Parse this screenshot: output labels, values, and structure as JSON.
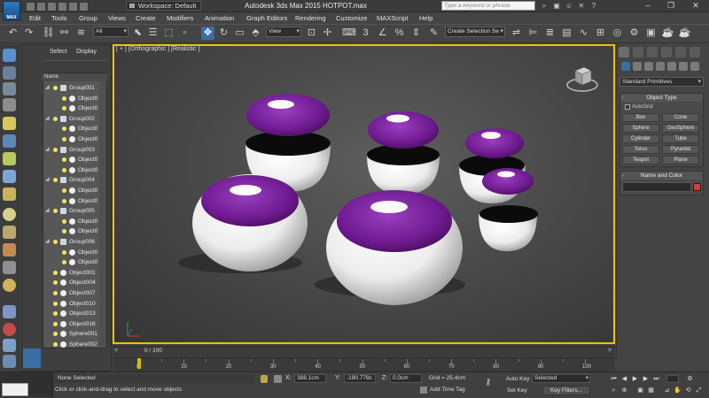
{
  "titlebar": {
    "logo": "MAX",
    "workspace": "Workspace: Default",
    "app_title": "Autodesk 3ds Max  2015      HOTPOT.max",
    "search_placeholder": "Type a keyword or phrase"
  },
  "menu": [
    "Edit",
    "Tools",
    "Group",
    "Views",
    "Create",
    "Modifiers",
    "Animation",
    "Graph Editors",
    "Rendering",
    "Customize",
    "MAXScript",
    "Help"
  ],
  "toolbar": {
    "selection_filter": "All",
    "reference_coord": "View",
    "named_selection_placeholder": "Create Selection Se"
  },
  "scene_explorer": {
    "tabs": [
      "Select",
      "Display"
    ],
    "column_header": "Name",
    "rows": [
      {
        "label": "Group001",
        "type": "group",
        "level": 0
      },
      {
        "label": "Object0",
        "type": "object",
        "level": 1
      },
      {
        "label": "Object0",
        "type": "object",
        "level": 1
      },
      {
        "label": "Group002",
        "type": "group",
        "level": 0
      },
      {
        "label": "Object0",
        "type": "object",
        "level": 1
      },
      {
        "label": "Object0",
        "type": "object",
        "level": 1
      },
      {
        "label": "Group003",
        "type": "group",
        "level": 0
      },
      {
        "label": "Object0",
        "type": "object",
        "level": 1
      },
      {
        "label": "Object0",
        "type": "object",
        "level": 1
      },
      {
        "label": "Group004",
        "type": "group",
        "level": 0
      },
      {
        "label": "Object0",
        "type": "object",
        "level": 1
      },
      {
        "label": "Object0",
        "type": "object",
        "level": 1
      },
      {
        "label": "Group005",
        "type": "group",
        "level": 0
      },
      {
        "label": "Object0",
        "type": "object",
        "level": 1
      },
      {
        "label": "Object0",
        "type": "object",
        "level": 1
      },
      {
        "label": "Group006",
        "type": "group",
        "level": 0
      },
      {
        "label": "Object0",
        "type": "object",
        "level": 1
      },
      {
        "label": "Object0",
        "type": "object",
        "level": 1
      },
      {
        "label": "Object001",
        "type": "object",
        "level": 0
      },
      {
        "label": "Object004",
        "type": "object",
        "level": 0
      },
      {
        "label": "Object007",
        "type": "object",
        "level": 0
      },
      {
        "label": "Object010",
        "type": "object",
        "level": 0
      },
      {
        "label": "Object013",
        "type": "object",
        "level": 0
      },
      {
        "label": "Object016",
        "type": "object",
        "level": 0
      },
      {
        "label": "Sphere001",
        "type": "object",
        "level": 0
      },
      {
        "label": "Sphere002",
        "type": "object",
        "level": 0
      }
    ]
  },
  "viewport": {
    "label": "[ + ] [Orthographic ] [Realistic ]",
    "border_color": "#e8c300",
    "pot_lid_color": "#7a1f9a",
    "pot_body_color": "#f2f2f2"
  },
  "command_panel": {
    "primitive_type": "Standard Primitives",
    "object_type_title": "Object Type",
    "autogrid_label": "AutoGrid",
    "buttons": [
      "Box",
      "Cone",
      "Sphere",
      "GeoSphere",
      "Cylinder",
      "Tube",
      "Torus",
      "Pyramid",
      "Teapot",
      "Plane"
    ],
    "name_color_title": "Name and Color",
    "swatch_color": "#d63a3a"
  },
  "timeline": {
    "frame_label": "0 / 100",
    "ticks": [
      "0",
      "10",
      "20",
      "30",
      "40",
      "50",
      "60",
      "70",
      "80",
      "90",
      "100"
    ]
  },
  "status": {
    "selection": "None Selected",
    "prompt": "Click or click-and-drag to select and move objects",
    "x_label": "X:",
    "x_value": "388.1cm",
    "y_label": "Y:",
    "y_value": "-190.778c",
    "z_label": "Z:",
    "z_value": "0.0cm",
    "grid": "Grid = 25.4cm",
    "add_time_tag": "Add Time Tag",
    "auto_key": "Auto Key",
    "set_key": "Set Key",
    "selected": "Selected",
    "key_filters": "Key Filters..."
  }
}
